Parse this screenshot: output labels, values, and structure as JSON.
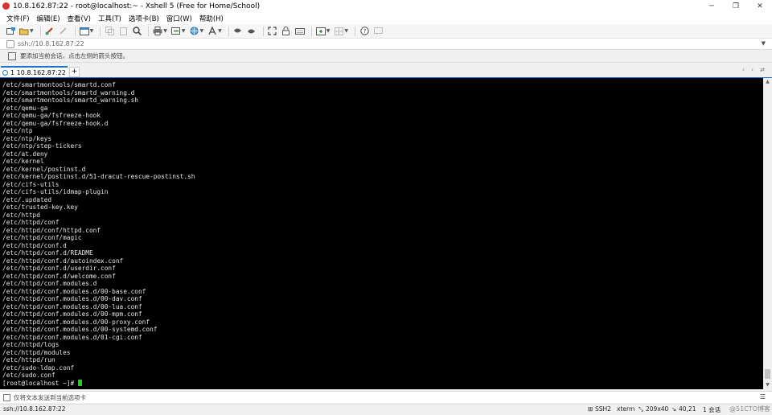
{
  "window": {
    "title": "10.8.162.87:22 - root@localhost:~ - Xshell 5 (Free for Home/School)",
    "controls": [
      "─",
      "❐",
      "✕"
    ]
  },
  "menu": [
    "文件(F)",
    "编辑(E)",
    "查看(V)",
    "工具(T)",
    "选项卡(B)",
    "窗口(W)",
    "帮助(H)"
  ],
  "address": {
    "value": "ssh://10.8.162.87:22"
  },
  "hint": {
    "text": "要添加当前会话，点击左侧的箭头按钮。"
  },
  "tabs": {
    "active_label": "1 10.8.162.87:22",
    "add": "+",
    "nav": "‹ › ⇄"
  },
  "terminal": {
    "lines": [
      "/etc/smartmontools/smartd.conf",
      "/etc/smartmontools/smartd_warning.d",
      "/etc/smartmontools/smartd_warning.sh",
      "/etc/qemu-ga",
      "/etc/qemu-ga/fsfreeze-hook",
      "/etc/qemu-ga/fsfreeze-hook.d",
      "/etc/ntp",
      "/etc/ntp/keys",
      "/etc/ntp/step-tickers",
      "/etc/at.deny",
      "/etc/kernel",
      "/etc/kernel/postinst.d",
      "/etc/kernel/postinst.d/51-dracut-rescue-postinst.sh",
      "/etc/cifs-utils",
      "/etc/cifs-utils/idmap-plugin",
      "/etc/.updated",
      "/etc/trusted-key.key",
      "/etc/httpd",
      "/etc/httpd/conf",
      "/etc/httpd/conf/httpd.conf",
      "/etc/httpd/conf/magic",
      "/etc/httpd/conf.d",
      "/etc/httpd/conf.d/README",
      "/etc/httpd/conf.d/autoindex.conf",
      "/etc/httpd/conf.d/userdir.conf",
      "/etc/httpd/conf.d/welcome.conf",
      "/etc/httpd/conf.modules.d",
      "/etc/httpd/conf.modules.d/00-base.conf",
      "/etc/httpd/conf.modules.d/00-dav.conf",
      "/etc/httpd/conf.modules.d/00-lua.conf",
      "/etc/httpd/conf.modules.d/00-mpm.conf",
      "/etc/httpd/conf.modules.d/00-proxy.conf",
      "/etc/httpd/conf.modules.d/00-systemd.conf",
      "/etc/httpd/conf.modules.d/01-cgi.conf",
      "/etc/httpd/logs",
      "/etc/httpd/modules",
      "/etc/httpd/run",
      "/etc/sudo-ldap.conf",
      "/etc/sudo.conf"
    ],
    "prompt": "[root@localhost ~]# "
  },
  "sendbar": {
    "text": "仅将文本发送到当前选项卡"
  },
  "status": {
    "address": "ssh://10.8.162.87:22",
    "protocol": "SSH2",
    "term": "xterm",
    "size": "209x40",
    "cursor_pos": "40,21",
    "sessions": "1 会话",
    "watermark": "@51CTO博客"
  },
  "colors": {
    "terminal_bg": "#000000",
    "terminal_fg": "#e8e8e8",
    "cursor": "#1bd11b",
    "accent": "#1a73c8"
  }
}
